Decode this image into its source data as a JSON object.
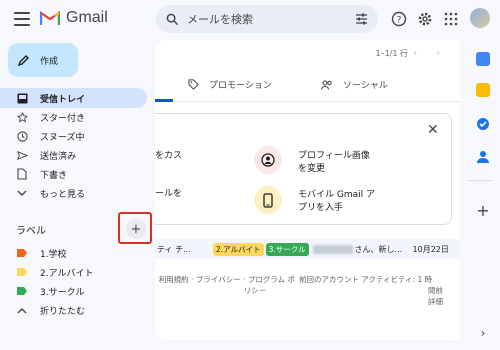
{
  "header": {
    "app_name": "Gmail",
    "search_placeholder": "メールを検索",
    "icons": [
      "menu-icon",
      "gmail-logo",
      "search-icon",
      "filter-options-icon",
      "help-icon",
      "settings-icon",
      "apps-grid-icon",
      "avatar"
    ]
  },
  "compose": {
    "label": "作成"
  },
  "nav": {
    "items": [
      {
        "label": "受信トレイ",
        "icon": "inbox-icon",
        "active": true
      },
      {
        "label": "スター付き",
        "icon": "star-icon"
      },
      {
        "label": "スヌーズ中",
        "icon": "clock-icon"
      },
      {
        "label": "送信済み",
        "icon": "send-icon"
      },
      {
        "label": "下書き",
        "icon": "draft-icon"
      },
      {
        "label": "もっと見る",
        "icon": "chevron-down-icon"
      }
    ]
  },
  "labels": {
    "heading": "ラベル",
    "add_symbol": "+",
    "items": [
      {
        "label": "1.学校",
        "color": "#f0641e"
      },
      {
        "label": "2.アルバイト",
        "color": "#fbd75b"
      },
      {
        "label": "3.サークル",
        "color": "#34a853"
      },
      {
        "label": "折りたたむ",
        "icon": "chevron-up-icon"
      }
    ]
  },
  "toolbar": {
    "pager": "1–1/1 行"
  },
  "tabs": [
    {
      "label": "プロモーション",
      "icon": "tag-icon"
    },
    {
      "label": "ソーシャル",
      "icon": "people-icon"
    }
  ],
  "setup_card": {
    "left_line1": "をカス",
    "left_line2": "ールを",
    "profile_line1": "プロフィール画像",
    "profile_line2": "を変更",
    "mobile_line1": "モバイル Gmail ア",
    "mobile_line2": "プリを入手",
    "close": "✕"
  },
  "email_row": {
    "subject": "ティ チ...",
    "badges": [
      {
        "label": "2.アルバイト",
        "color": "#fbd75b"
      },
      {
        "label": "3.サークル",
        "color": "#34a853"
      }
    ],
    "snippet": "さん、新し...",
    "date": "10月22日"
  },
  "footer": {
    "links": "利用規約 · プライバシー · プログラム ポ",
    "links2": "リシー",
    "activity": "前回のアカウント アクティビティ: 1 時",
    "activity2": "間前",
    "details": "詳細"
  },
  "colors": {
    "accent": "#0b57d0",
    "compose_bg": "#c2e7ff",
    "active_nav": "#d3e3fd",
    "highlight_border": "#d93025"
  }
}
